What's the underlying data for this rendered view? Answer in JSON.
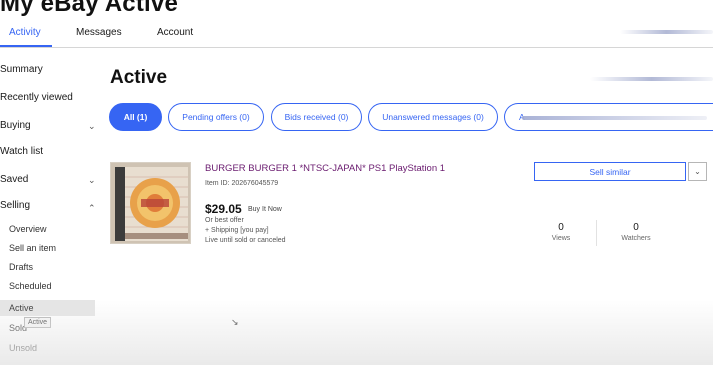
{
  "page": {
    "title": "My eBay Active"
  },
  "top_tabs": [
    {
      "label": "Activity",
      "active": true
    },
    {
      "label": "Messages",
      "active": false
    },
    {
      "label": "Account",
      "active": false
    }
  ],
  "sidebar": {
    "summary": "Summary",
    "recently_viewed": "Recently viewed",
    "buying": "Buying",
    "watch_list": "Watch list",
    "saved": "Saved",
    "selling": "Selling",
    "selling_items": [
      "Overview",
      "Sell an item",
      "Drafts",
      "Scheduled",
      "Active",
      "Sold",
      "Unsold"
    ],
    "tooltip": "Active"
  },
  "main": {
    "title": "Active",
    "filters": [
      {
        "label": "All (1)",
        "active": true
      },
      {
        "label": "Pending offers (0)",
        "active": false
      },
      {
        "label": "Bids received (0)",
        "active": false
      },
      {
        "label": "Unanswered messages (0)",
        "active": false
      },
      {
        "label": "A",
        "active": false
      }
    ]
  },
  "listing": {
    "title": "BURGER BURGER 1 *NTSC-JAPAN* PS1 PlayStation 1",
    "item_id": "Item ID: 202676045579",
    "price": "$29.05",
    "format": "Buy It Now",
    "offer": "Or best offer",
    "shipping": "+ Shipping [you pay]",
    "duration": "Live until sold or canceled",
    "sell_similar": "Sell similar",
    "views_count": "0",
    "views_label": "Views",
    "watchers_count": "0",
    "watchers_label": "Watchers"
  },
  "colors": {
    "accent": "#3665f3",
    "title_purple": "#6a1b6f"
  },
  "icons": [
    "chevron-down-icon",
    "chevron-up-icon",
    "mouse-cursor-icon"
  ]
}
